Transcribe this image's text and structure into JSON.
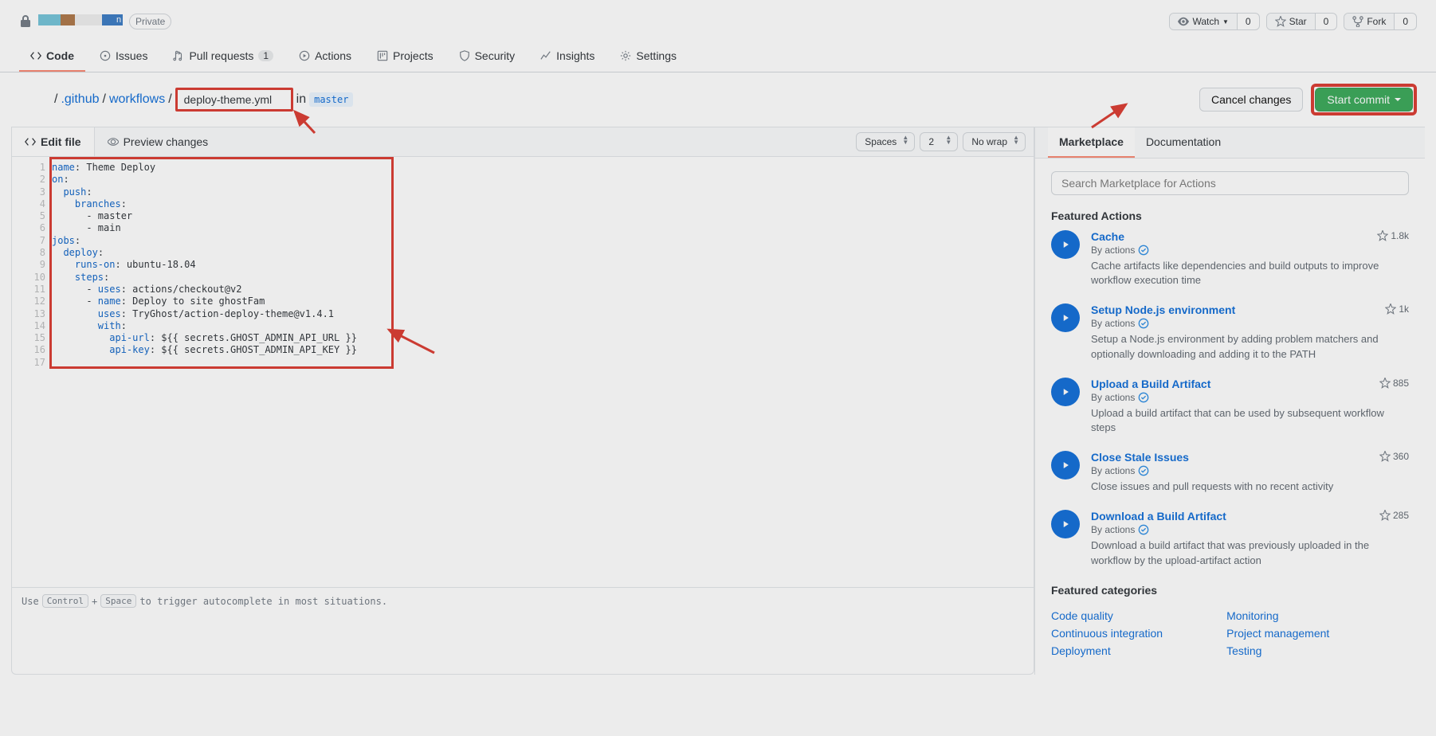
{
  "repo": {
    "private_label": "Private",
    "watch_label": "Watch",
    "watch_count": "0",
    "star_label": "Star",
    "star_count": "0",
    "fork_label": "Fork",
    "fork_count": "0"
  },
  "nav": {
    "code": "Code",
    "issues": "Issues",
    "pulls": "Pull requests",
    "pulls_count": "1",
    "actions": "Actions",
    "projects": "Projects",
    "security": "Security",
    "insights": "Insights",
    "settings": "Settings"
  },
  "breadcrumb": {
    "sep": "/",
    "seg1": ".github",
    "seg2": "workflows",
    "filename": "deploy-theme.yml",
    "in_text": "in",
    "branch": "master"
  },
  "buttons": {
    "cancel": "Cancel changes",
    "commit": "Start commit"
  },
  "editor": {
    "edit_tab": "Edit file",
    "preview_tab": "Preview changes",
    "indent": "Spaces",
    "indent_size": "2",
    "wrap": "No wrap",
    "footer_pre": "Use ",
    "kbd1": "Control",
    "plus": " + ",
    "kbd2": "Space",
    "footer_post": " to trigger autocomplete in most situations."
  },
  "code_lines": [
    [
      [
        "name",
        "k"
      ],
      [
        ":",
        "p"
      ],
      [
        " Theme Deploy",
        "p"
      ]
    ],
    [
      [
        "on",
        "k"
      ],
      [
        ":",
        "p"
      ]
    ],
    [
      [
        "  ",
        "p"
      ],
      [
        "push",
        "k"
      ],
      [
        ":",
        "p"
      ]
    ],
    [
      [
        "    ",
        "p"
      ],
      [
        "branches",
        "k"
      ],
      [
        ":",
        "p"
      ]
    ],
    [
      [
        "      - master",
        "p"
      ]
    ],
    [
      [
        "      - main",
        "p"
      ]
    ],
    [
      [
        "jobs",
        "k"
      ],
      [
        ":",
        "p"
      ]
    ],
    [
      [
        "  ",
        "p"
      ],
      [
        "deploy",
        "k"
      ],
      [
        ":",
        "p"
      ]
    ],
    [
      [
        "    ",
        "p"
      ],
      [
        "runs-on",
        "k"
      ],
      [
        ":",
        "p"
      ],
      [
        " ubuntu-18.04",
        "p"
      ]
    ],
    [
      [
        "    ",
        "p"
      ],
      [
        "steps",
        "k"
      ],
      [
        ":",
        "p"
      ]
    ],
    [
      [
        "      - ",
        "p"
      ],
      [
        "uses",
        "k"
      ],
      [
        ":",
        "p"
      ],
      [
        " actions/checkout@v2",
        "p"
      ]
    ],
    [
      [
        "      - ",
        "p"
      ],
      [
        "name",
        "k"
      ],
      [
        ":",
        "p"
      ],
      [
        " Deploy to site ghostFam",
        "p"
      ]
    ],
    [
      [
        "        ",
        "p"
      ],
      [
        "uses",
        "k"
      ],
      [
        ":",
        "p"
      ],
      [
        " TryGhost/action-deploy-theme@v1.4.1",
        "p"
      ]
    ],
    [
      [
        "        ",
        "p"
      ],
      [
        "with",
        "k"
      ],
      [
        ":",
        "p"
      ]
    ],
    [
      [
        "          ",
        "p"
      ],
      [
        "api-url",
        "k"
      ],
      [
        ":",
        "p"
      ],
      [
        " ${{ secrets.GHOST_ADMIN_API_URL }}",
        "p"
      ]
    ],
    [
      [
        "          ",
        "p"
      ],
      [
        "api-key",
        "k"
      ],
      [
        ":",
        "p"
      ],
      [
        " ${{ secrets.GHOST_ADMIN_API_KEY }}",
        "p"
      ]
    ],
    [
      [
        "",
        "p"
      ]
    ]
  ],
  "sidebar": {
    "tab_market": "Marketplace",
    "tab_docs": "Documentation",
    "search_placeholder": "Search Marketplace for Actions",
    "featured_h": "Featured Actions",
    "by_text": "By actions",
    "actions": [
      {
        "title": "Cache",
        "stars": "1.8k",
        "desc": "Cache artifacts like dependencies and build outputs to improve workflow execution time"
      },
      {
        "title": "Setup Node.js environment",
        "stars": "1k",
        "desc": "Setup a Node.js environment by adding problem matchers and optionally downloading and adding it to the PATH"
      },
      {
        "title": "Upload a Build Artifact",
        "stars": "885",
        "desc": "Upload a build artifact that can be used by subsequent workflow steps"
      },
      {
        "title": "Close Stale Issues",
        "stars": "360",
        "desc": "Close issues and pull requests with no recent activity"
      },
      {
        "title": "Download a Build Artifact",
        "stars": "285",
        "desc": "Download a build artifact that was previously uploaded in the workflow by the upload-artifact action"
      }
    ],
    "cat_h": "Featured categories",
    "cats_left": [
      "Code quality",
      "Continuous integration",
      "Deployment"
    ],
    "cats_right": [
      "Monitoring",
      "Project management",
      "Testing"
    ]
  }
}
